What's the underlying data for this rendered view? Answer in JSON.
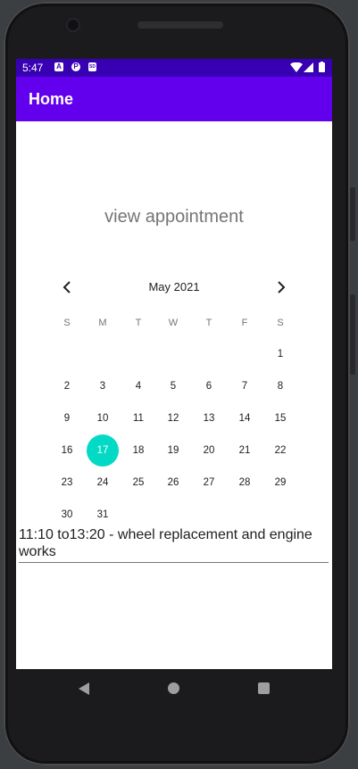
{
  "status_bar": {
    "time": "5:47",
    "notification_icons": [
      "A",
      "P",
      "SD"
    ]
  },
  "app_bar": {
    "title": "Home"
  },
  "main": {
    "heading": "view appointment",
    "calendar": {
      "month_label": "May 2021",
      "weekdays": [
        "S",
        "M",
        "T",
        "W",
        "T",
        "F",
        "S"
      ],
      "selected_day": "17",
      "weeks": [
        [
          "",
          "",
          "",
          "",
          "",
          "",
          "1"
        ],
        [
          "2",
          "3",
          "4",
          "5",
          "6",
          "7",
          "8"
        ],
        [
          "9",
          "10",
          "11",
          "12",
          "13",
          "14",
          "15"
        ],
        [
          "16",
          "17",
          "18",
          "19",
          "20",
          "21",
          "22"
        ],
        [
          "23",
          "24",
          "25",
          "26",
          "27",
          "28",
          "29"
        ],
        [
          "30",
          "31",
          "",
          "",
          "",
          "",
          ""
        ]
      ]
    },
    "appointment_text": "11:10 to13:20 - wheel replacement and engine works"
  },
  "colors": {
    "status_bar": "#3700b3",
    "app_bar": "#6200ee",
    "selected_day": "#03dac5"
  }
}
